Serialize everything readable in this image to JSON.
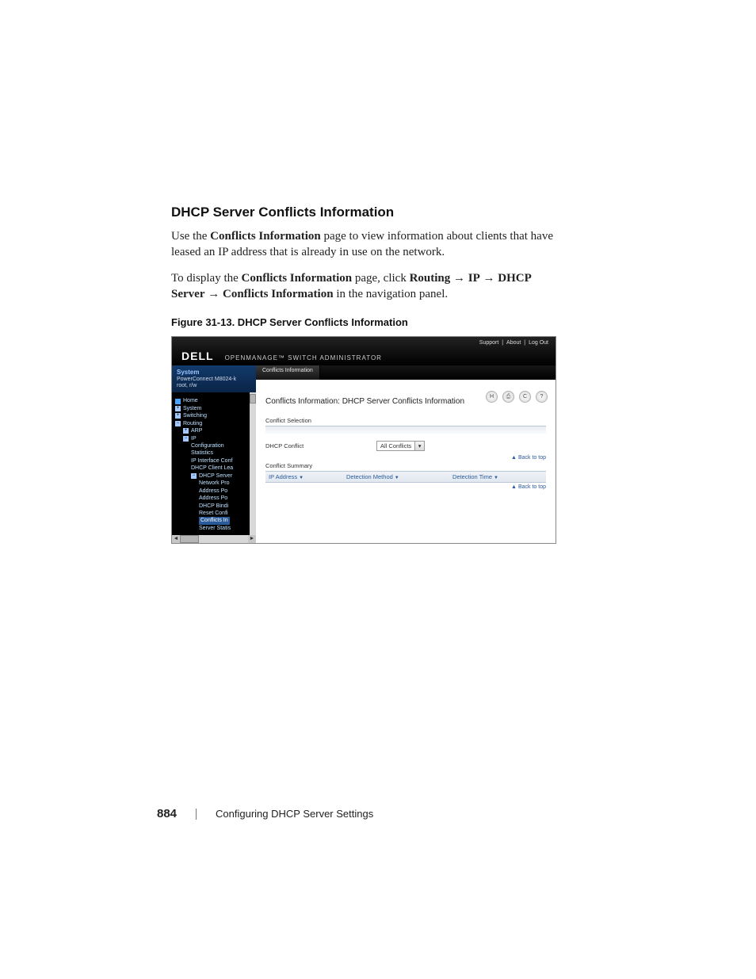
{
  "doc": {
    "section_heading": "DHCP Server Conflicts Information",
    "para1_a": "Use the ",
    "para1_b": "Conflicts Information",
    "para1_c": " page to view information about clients that have leased an IP address that is already in use on the network.",
    "para2_a": "To display the ",
    "para2_b": "Conflicts Information",
    "para2_c": " page, click ",
    "nav_routing": "Routing",
    "nav_ip": "IP",
    "nav_dhcp_server": "DHCP Server",
    "nav_conflicts": "Conflicts Information",
    "para2_d": " in the navigation panel.",
    "arrow": "→",
    "figure_caption": "Figure 31-13.    DHCP Server Conflicts Information"
  },
  "screenshot": {
    "top_links": {
      "support": "Support",
      "about": "About",
      "logout": "Log Out",
      "sep": "|"
    },
    "brand_logo": "DELL",
    "brand_sub": "OPENMANAGE™ SWITCH ADMINISTRATOR",
    "sidebar": {
      "head_system": "System",
      "head_device": "PowerConnect M8024-k",
      "head_user": "root, r/w",
      "tree": {
        "home": "Home",
        "system": "System",
        "switching": "Switching",
        "routing": "Routing",
        "arp": "ARP",
        "ip": "IP",
        "configuration": "Configuration",
        "statistics": "Statistics",
        "ip_interface": "IP Interface Conf",
        "dhcp_client": "DHCP Client Lea",
        "dhcp_server": "DHCP Server",
        "network_pro": "Network Pro",
        "address_po1": "Address Po",
        "address_po2": "Address Po",
        "dhcp_bind": "DHCP Bindi",
        "reset_conf": "Reset Confi",
        "conflicts": "Conflicts In",
        "server_stats": "Server Statis"
      }
    },
    "tab": "Conflicts Information",
    "page_title": "Conflicts Information: DHCP Server Conflicts Information",
    "toolbar": {
      "save": "H",
      "print": "⎙",
      "refresh": "C",
      "help": "?"
    },
    "panel1_label": "Conflict Selection",
    "row1_label": "DHCP Conflict",
    "row1_value": "All Conflicts",
    "panel2_label": "Conflict Summary",
    "back_to_top": "Back to top",
    "table": {
      "col1": "IP Address",
      "col2": "Detection Method",
      "col3": "Detection Time"
    }
  },
  "footer": {
    "page_number": "884",
    "chapter": "Configuring DHCP Server Settings"
  }
}
